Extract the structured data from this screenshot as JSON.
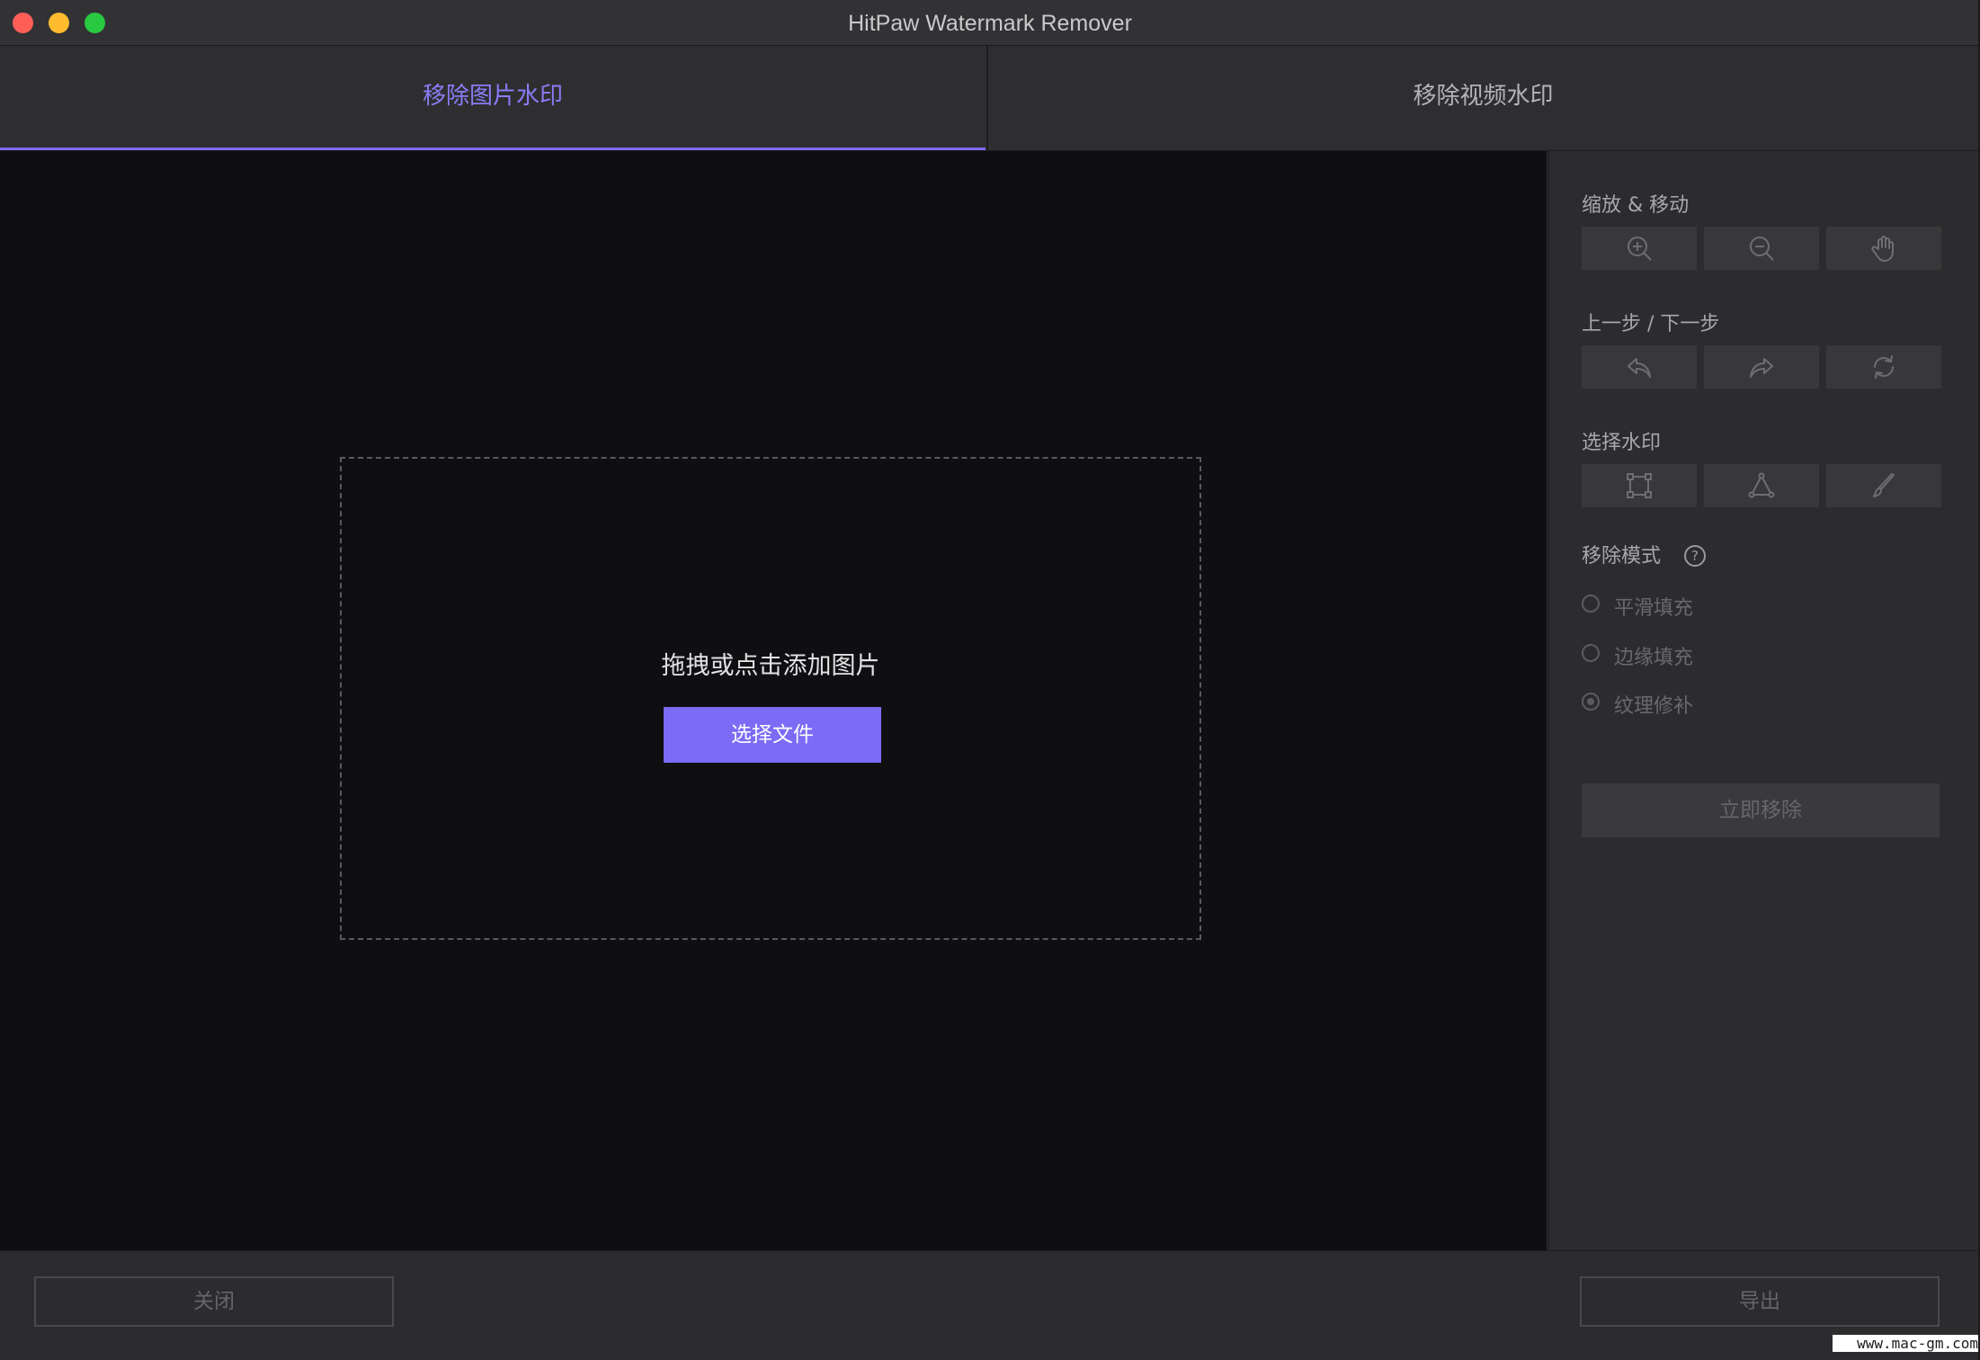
{
  "window": {
    "title": "HitPaw Watermark Remover"
  },
  "tabs": [
    {
      "label": "移除图片水印",
      "active": true
    },
    {
      "label": "移除视频水印",
      "active": false
    }
  ],
  "canvas": {
    "drop_text": "拖拽或点击添加图片",
    "select_button": "选择文件"
  },
  "panel": {
    "zoom_move": {
      "title": "缩放 & 移动",
      "tools": [
        "zoom-in-icon",
        "zoom-out-icon",
        "hand-icon"
      ]
    },
    "undo_redo": {
      "title": "上一步 / 下一步",
      "tools": [
        "undo-icon",
        "redo-icon",
        "reset-icon"
      ]
    },
    "select_watermark": {
      "title": "选择水印",
      "tools": [
        "rectangle-select-icon",
        "polygon-select-icon",
        "brush-icon"
      ]
    },
    "remove_mode": {
      "title": "移除模式",
      "help": "?",
      "options": [
        {
          "label": "平滑填充",
          "checked": false
        },
        {
          "label": "边缘填充",
          "checked": false
        },
        {
          "label": "纹理修补",
          "checked": true
        }
      ]
    },
    "remove_button": "立即移除"
  },
  "footer": {
    "close_button": "关闭",
    "export_button": "导出"
  },
  "watermark_text": "www.mac-gm.com",
  "colors": {
    "accent": "#7b6bf5",
    "canvas_bg": "#0f0f11",
    "panel_bg": "#2c2c2e"
  }
}
